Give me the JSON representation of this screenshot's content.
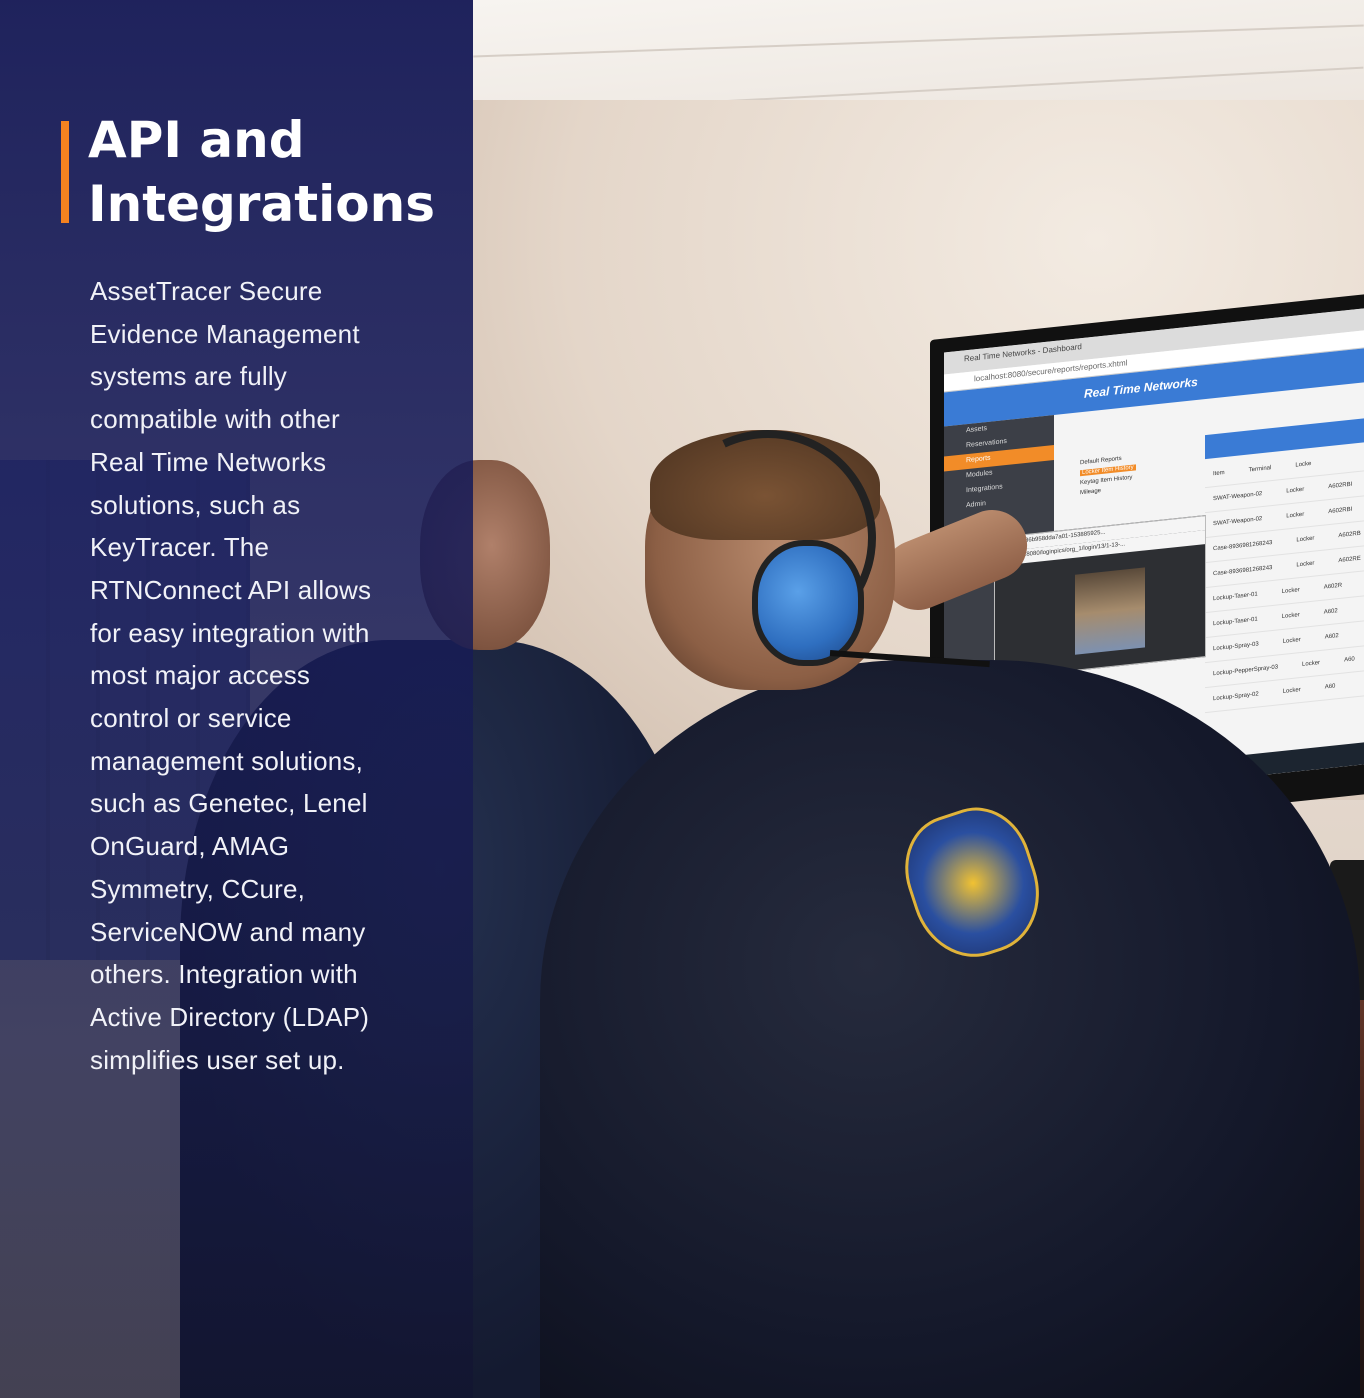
{
  "panel": {
    "title_line1": "API and",
    "title_line2": "Integrations",
    "body": "AssetTracer Secure Evidence Management systems are fully compatible with other Real Time Networks solutions, such as KeyTracer. The RTNConnect API allows for easy integration with most major access control or service management solutions, such as Genetec, Lenel OnGuard, AMAG Symmetry, CCure, ServiceNOW and many others. Integration with Active Directory (LDAP) simplifies user set up."
  },
  "colors": {
    "panel_background": "#1c2060",
    "accent_bar": "#f58220",
    "title_text": "#ffffff",
    "body_text": "#f1f2f8"
  },
  "monitor_app": {
    "tab_title": "Real Time Networks - Dashboard",
    "url": "localhost:8080/secure/reports/reports.xhtml",
    "header_title": "Real Time Networks",
    "logo_text": "Real Time Networks",
    "sidebar_items": [
      "Assets",
      "Reservations",
      "Reports",
      "Modules",
      "Integrations",
      "Admin"
    ],
    "report_tree": [
      "Default Reports",
      "Locker Item History",
      "Keytag Item History",
      "Mileage"
    ],
    "table_headers": [
      "Item",
      "Terminal",
      "Locke"
    ],
    "table_rows": [
      [
        "SWAT-Weapon-02",
        "Locker",
        "A602RBI"
      ],
      [
        "SWAT-Weapon-02",
        "Locker",
        "A602RBI"
      ],
      [
        "Case-8936981268243",
        "Locker",
        "A602RB"
      ],
      [
        "Case-8936981268243",
        "Locker",
        "A602RE"
      ],
      [
        "Lockup-Taser-01",
        "Locker",
        "A602R"
      ],
      [
        "Lockup-Taser-01",
        "Locker",
        "A602"
      ],
      [
        "Lockup-Spray-03",
        "Locker",
        "A602"
      ],
      [
        "Lockup-PepperSpray-03",
        "Locker",
        "A60"
      ],
      [
        "Lockup-Spray-02",
        "Locker",
        "A60"
      ]
    ],
    "video_window_title": "1-13-9a986b958dda7a01-153885925...",
    "video_window_url": "localhost:8080/loginpics/org_1/login/13/1-13-..."
  }
}
